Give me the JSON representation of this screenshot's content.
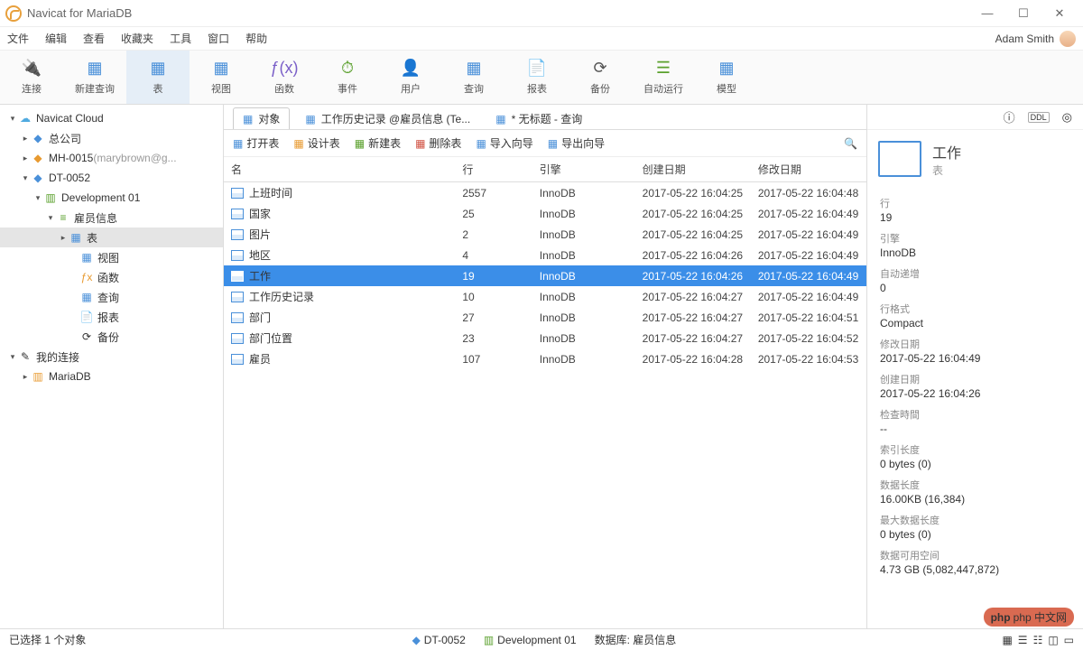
{
  "window": {
    "title": "Navicat for MariaDB",
    "user": "Adam Smith"
  },
  "menu": [
    "文件",
    "编辑",
    "查看",
    "收藏夹",
    "工具",
    "窗口",
    "帮助"
  ],
  "toolbar": [
    {
      "icon": "🔌",
      "label": "连接",
      "cls": "ic-plug"
    },
    {
      "icon": "▦",
      "label": "新建查询",
      "cls": "ic-blue"
    },
    {
      "icon": "▦",
      "label": "表",
      "cls": "ic-blue",
      "active": true
    },
    {
      "icon": "▦",
      "label": "视图",
      "cls": "ic-blue"
    },
    {
      "icon": "ƒ(x)",
      "label": "函数",
      "cls": "ic-purple"
    },
    {
      "icon": "⏱",
      "label": "事件",
      "cls": "ic-green"
    },
    {
      "icon": "👤",
      "label": "用户",
      "cls": "ic-orange"
    },
    {
      "icon": "▦",
      "label": "查询",
      "cls": "ic-blue"
    },
    {
      "icon": "📄",
      "label": "报表",
      "cls": "ic-teal"
    },
    {
      "icon": "⟳",
      "label": "备份",
      "cls": "ic-plug"
    },
    {
      "icon": "☰",
      "label": "自动运行",
      "cls": "ic-green"
    },
    {
      "icon": "▦",
      "label": "模型",
      "cls": "ic-blue"
    }
  ],
  "tree": [
    {
      "ind": 0,
      "chev": "▾",
      "icon": "☁",
      "cls": "cloud",
      "label": "Navicat Cloud"
    },
    {
      "ind": 1,
      "chev": "▸",
      "icon": "◆",
      "cls": "ic-blue",
      "label": "总公司"
    },
    {
      "ind": 1,
      "chev": "▸",
      "icon": "◆",
      "cls": "ic-orange",
      "label": "MH-0015",
      "suffix": "(marybrown@g..."
    },
    {
      "ind": 1,
      "chev": "▾",
      "icon": "◆",
      "cls": "ic-blue",
      "label": "DT-0052"
    },
    {
      "ind": 2,
      "chev": "▾",
      "icon": "▥",
      "cls": "ic-green",
      "label": "Development 01"
    },
    {
      "ind": 3,
      "chev": "▾",
      "icon": "≡",
      "cls": "ic-green",
      "label": "雇员信息"
    },
    {
      "ind": 4,
      "chev": "▸",
      "icon": "▦",
      "cls": "ic-blue",
      "label": "表",
      "sel": true
    },
    {
      "ind": 5,
      "chev": "",
      "icon": "▦",
      "cls": "ic-blue",
      "label": "视图"
    },
    {
      "ind": 5,
      "chev": "",
      "icon": "ƒx",
      "cls": "ic-orange",
      "label": "函数"
    },
    {
      "ind": 5,
      "chev": "",
      "icon": "▦",
      "cls": "ic-blue",
      "label": "查询"
    },
    {
      "ind": 5,
      "chev": "",
      "icon": "📄",
      "cls": "ic-teal",
      "label": "报表"
    },
    {
      "ind": 5,
      "chev": "",
      "icon": "⟳",
      "cls": "",
      "label": "备份"
    },
    {
      "ind": 0,
      "chev": "▾",
      "icon": "✎",
      "cls": "",
      "label": "我的连接"
    },
    {
      "ind": 1,
      "chev": "▸",
      "icon": "▥",
      "cls": "ic-orange",
      "label": "MariaDB"
    }
  ],
  "tabs": [
    {
      "icon": "▦",
      "label": "对象",
      "active": true
    },
    {
      "icon": "▦",
      "label": "工作历史记录 @雇员信息 (Te..."
    },
    {
      "icon": "▦",
      "label": "* 无标题 - 查询"
    }
  ],
  "subtoolbar": [
    {
      "icon": "▦",
      "label": "打开表",
      "cls": "ic-blue"
    },
    {
      "icon": "✎",
      "label": "设计表",
      "cls": "ic-orange"
    },
    {
      "icon": "＋",
      "label": "新建表",
      "cls": "ic-green"
    },
    {
      "icon": "－",
      "label": "删除表",
      "cls": "ic-red"
    },
    {
      "icon": "⤓",
      "label": "导入向导",
      "cls": "ic-blue"
    },
    {
      "icon": "⤒",
      "label": "导出向导",
      "cls": "ic-blue"
    }
  ],
  "columns": [
    "名",
    "行",
    "引擎",
    "创建日期",
    "修改日期"
  ],
  "rows": [
    {
      "name": "上班时间",
      "rows": "2557",
      "engine": "InnoDB",
      "created": "2017-05-22 16:04:25",
      "modified": "2017-05-22 16:04:48"
    },
    {
      "name": "国家",
      "rows": "25",
      "engine": "InnoDB",
      "created": "2017-05-22 16:04:25",
      "modified": "2017-05-22 16:04:49"
    },
    {
      "name": "图片",
      "rows": "2",
      "engine": "InnoDB",
      "created": "2017-05-22 16:04:25",
      "modified": "2017-05-22 16:04:49"
    },
    {
      "name": "地区",
      "rows": "4",
      "engine": "InnoDB",
      "created": "2017-05-22 16:04:26",
      "modified": "2017-05-22 16:04:49"
    },
    {
      "name": "工作",
      "rows": "19",
      "engine": "InnoDB",
      "created": "2017-05-22 16:04:26",
      "modified": "2017-05-22 16:04:49",
      "sel": true
    },
    {
      "name": "工作历史记录",
      "rows": "10",
      "engine": "InnoDB",
      "created": "2017-05-22 16:04:27",
      "modified": "2017-05-22 16:04:49"
    },
    {
      "name": "部门",
      "rows": "27",
      "engine": "InnoDB",
      "created": "2017-05-22 16:04:27",
      "modified": "2017-05-22 16:04:51"
    },
    {
      "name": "部门位置",
      "rows": "23",
      "engine": "InnoDB",
      "created": "2017-05-22 16:04:27",
      "modified": "2017-05-22 16:04:52"
    },
    {
      "name": "雇员",
      "rows": "107",
      "engine": "InnoDB",
      "created": "2017-05-22 16:04:28",
      "modified": "2017-05-22 16:04:53"
    }
  ],
  "details": {
    "title": "工作",
    "subtitle": "表",
    "props": [
      {
        "k": "行",
        "v": "19"
      },
      {
        "k": "引擎",
        "v": "InnoDB"
      },
      {
        "k": "自动递增",
        "v": "0"
      },
      {
        "k": "行格式",
        "v": "Compact"
      },
      {
        "k": "修改日期",
        "v": "2017-05-22 16:04:49"
      },
      {
        "k": "创建日期",
        "v": "2017-05-22 16:04:26"
      },
      {
        "k": "检查時間",
        "v": "--"
      },
      {
        "k": "索引长度",
        "v": "0 bytes (0)"
      },
      {
        "k": "数据长度",
        "v": "16.00KB (16,384)"
      },
      {
        "k": "最大数据长度",
        "v": "0 bytes (0)"
      },
      {
        "k": "数据可用空间",
        "v": "4.73 GB (5,082,447,872)"
      }
    ]
  },
  "status": {
    "left": "已选择 1 个对象",
    "conn": "DT-0052",
    "db": "Development 01",
    "schema": "数据库: 雇员信息"
  },
  "watermark": "php 中文网"
}
